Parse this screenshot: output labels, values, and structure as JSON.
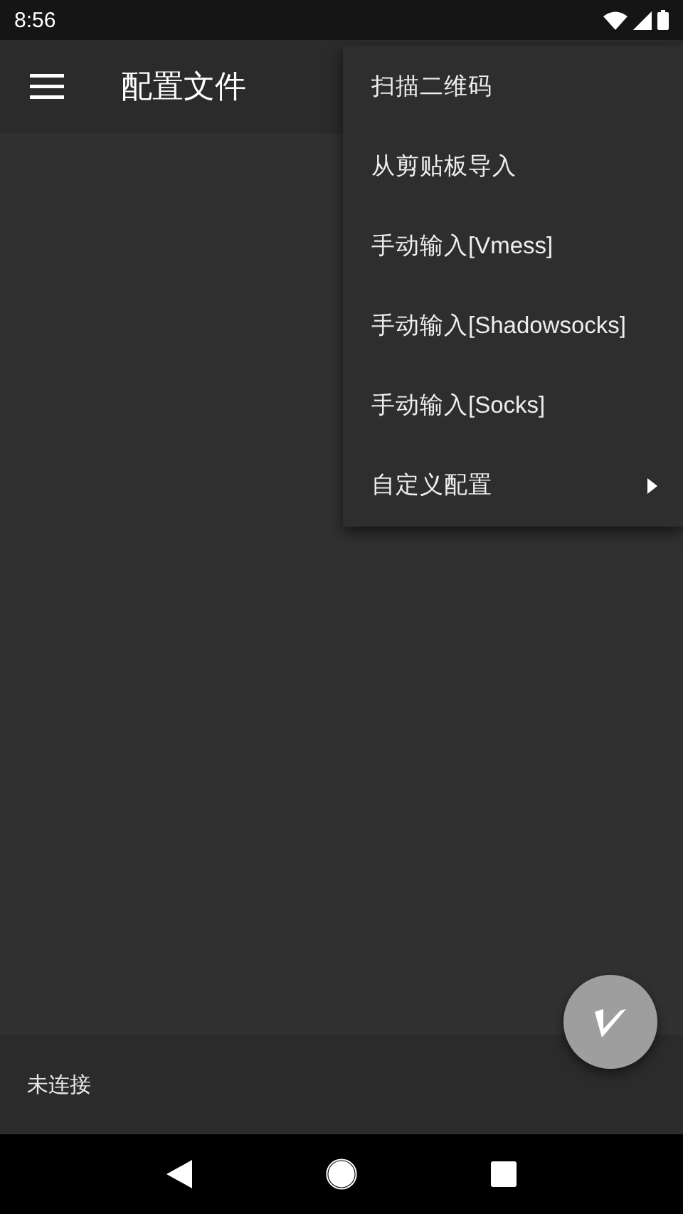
{
  "status_bar": {
    "time": "8:56"
  },
  "app_bar": {
    "title": "配置文件"
  },
  "menu": {
    "items": [
      {
        "label": "扫描二维码",
        "kind": "plain"
      },
      {
        "label": "从剪贴板导入",
        "kind": "plain"
      },
      {
        "label": "手动输入[Vmess]",
        "kind": "plain"
      },
      {
        "label": "手动输入[Shadowsocks]",
        "kind": "plain"
      },
      {
        "label": "手动输入[Socks]",
        "kind": "plain"
      },
      {
        "label": "自定义配置",
        "kind": "submenu"
      }
    ]
  },
  "footer": {
    "status": "未连接"
  }
}
